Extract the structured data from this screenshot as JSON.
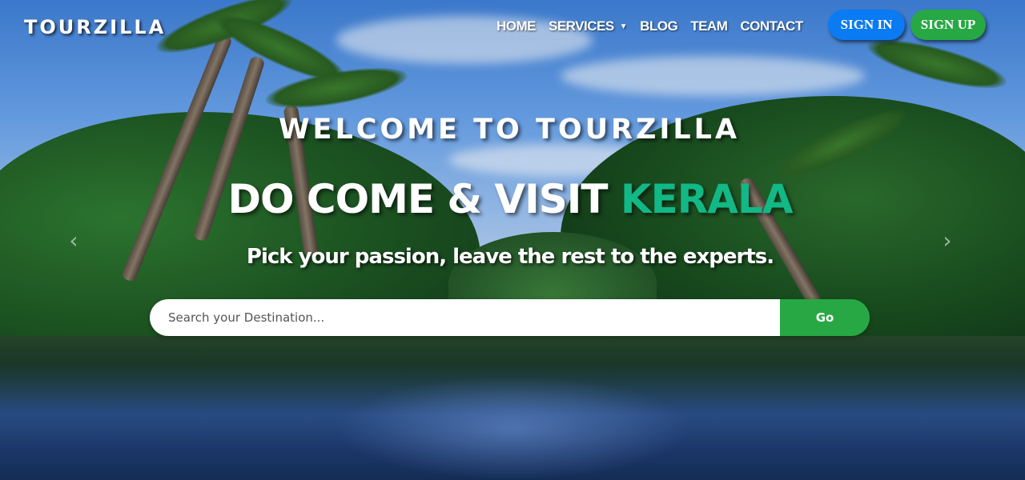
{
  "brand": {
    "logo_text": "TOURZILLA"
  },
  "nav": {
    "items": [
      {
        "label": "HOME"
      },
      {
        "label": "SERVICES",
        "has_dropdown": true
      },
      {
        "label": "BLOG"
      },
      {
        "label": "TEAM"
      },
      {
        "label": "CONTACT"
      }
    ],
    "sign_in_label": "SIGN IN",
    "sign_up_label": "SIGN UP"
  },
  "hero": {
    "welcome": "WELCOME TO TOURZILLA",
    "headline_prefix": "DO COME & VISIT ",
    "headline_highlight": "KERALA",
    "tagline": "Pick your passion, leave the rest to the experts.",
    "search_placeholder": "Search your Destination...",
    "search_button": "Go"
  },
  "carousel": {
    "prev_icon": "chevron-left-icon",
    "next_icon": "chevron-right-icon"
  },
  "colors": {
    "sign_in": "#0a7bf2",
    "sign_up": "#28a745",
    "highlight": "#12b886",
    "go_button": "#28a745"
  }
}
